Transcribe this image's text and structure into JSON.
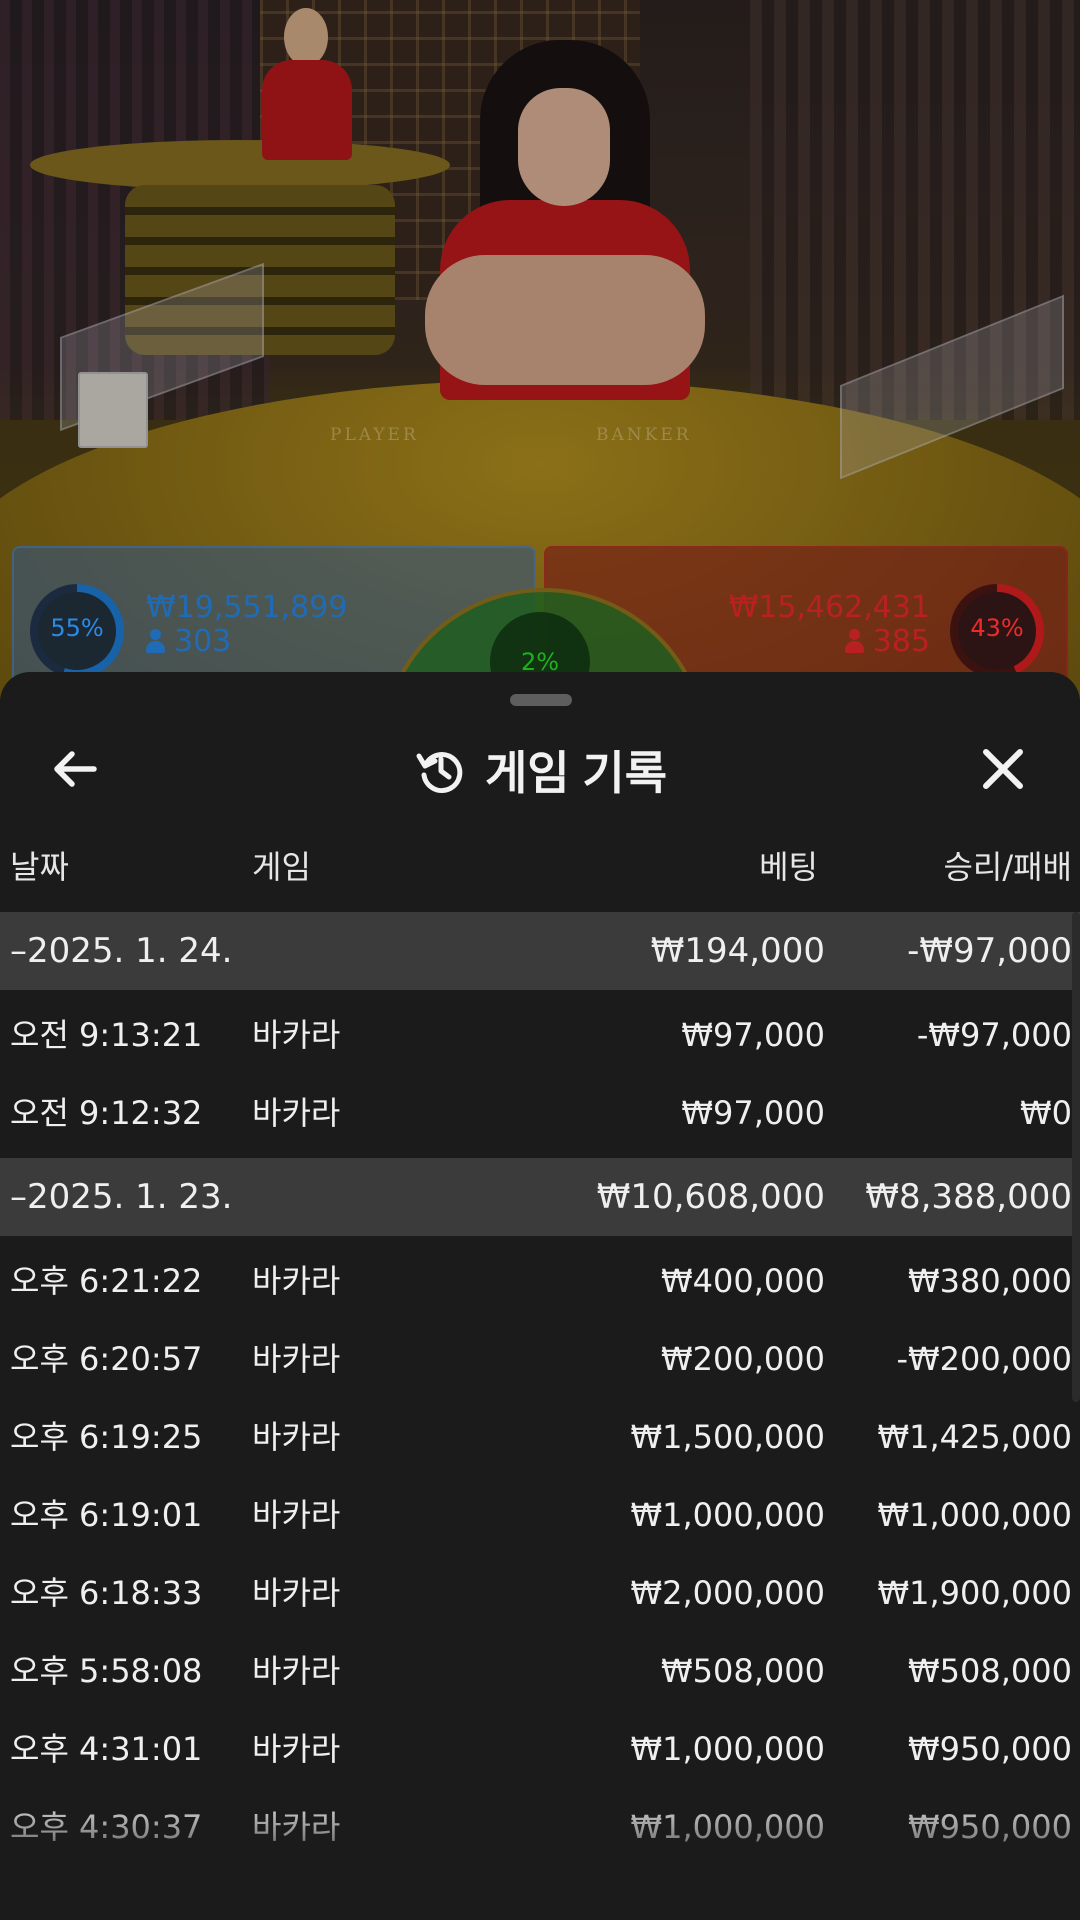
{
  "video": {
    "table_labels": {
      "player": "PLAYER",
      "banker": "BANKER"
    }
  },
  "bets": {
    "player": {
      "percent": "55%",
      "amount": "₩19,551,899",
      "count": "303",
      "color": "#2a8ae8",
      "fill": 0.55
    },
    "tie": {
      "percent": "2%",
      "color": "#2adf2a",
      "fill": 0.02
    },
    "banker": {
      "percent": "43%",
      "amount": "₩15,462,431",
      "count": "385",
      "color": "#ee2a2a",
      "fill": 0.43
    }
  },
  "sheet": {
    "title": "게임 기록",
    "icons": {
      "back": "arrow-left-icon",
      "history": "history-icon",
      "close": "close-icon"
    },
    "columns": {
      "date": "날짜",
      "game": "게임",
      "bet": "베팅",
      "result": "승리/패배"
    },
    "groups": [
      {
        "date": "–2025. 1. 24.",
        "bet": "₩194,000",
        "result": "-₩97,000",
        "rows": [
          {
            "time": "오전 9:13:21",
            "game": "바카라",
            "bet": "₩97,000",
            "result": "-₩97,000"
          },
          {
            "time": "오전 9:12:32",
            "game": "바카라",
            "bet": "₩97,000",
            "result": "₩0"
          }
        ]
      },
      {
        "date": "–2025. 1. 23.",
        "bet": "₩10,608,000",
        "result": "₩8,388,000",
        "rows": [
          {
            "time": "오후 6:21:22",
            "game": "바카라",
            "bet": "₩400,000",
            "result": "₩380,000"
          },
          {
            "time": "오후 6:20:57",
            "game": "바카라",
            "bet": "₩200,000",
            "result": "-₩200,000"
          },
          {
            "time": "오후 6:19:25",
            "game": "바카라",
            "bet": "₩1,500,000",
            "result": "₩1,425,000"
          },
          {
            "time": "오후 6:19:01",
            "game": "바카라",
            "bet": "₩1,000,000",
            "result": "₩1,000,000"
          },
          {
            "time": "오후 6:18:33",
            "game": "바카라",
            "bet": "₩2,000,000",
            "result": "₩1,900,000"
          },
          {
            "time": "오후 5:58:08",
            "game": "바카라",
            "bet": "₩508,000",
            "result": "₩508,000"
          },
          {
            "time": "오후 4:31:01",
            "game": "바카라",
            "bet": "₩1,000,000",
            "result": "₩950,000"
          },
          {
            "time": "오후 4:30:37",
            "game": "바카라",
            "bet": "₩1,000,000",
            "result": "₩950,000"
          }
        ]
      }
    ]
  }
}
